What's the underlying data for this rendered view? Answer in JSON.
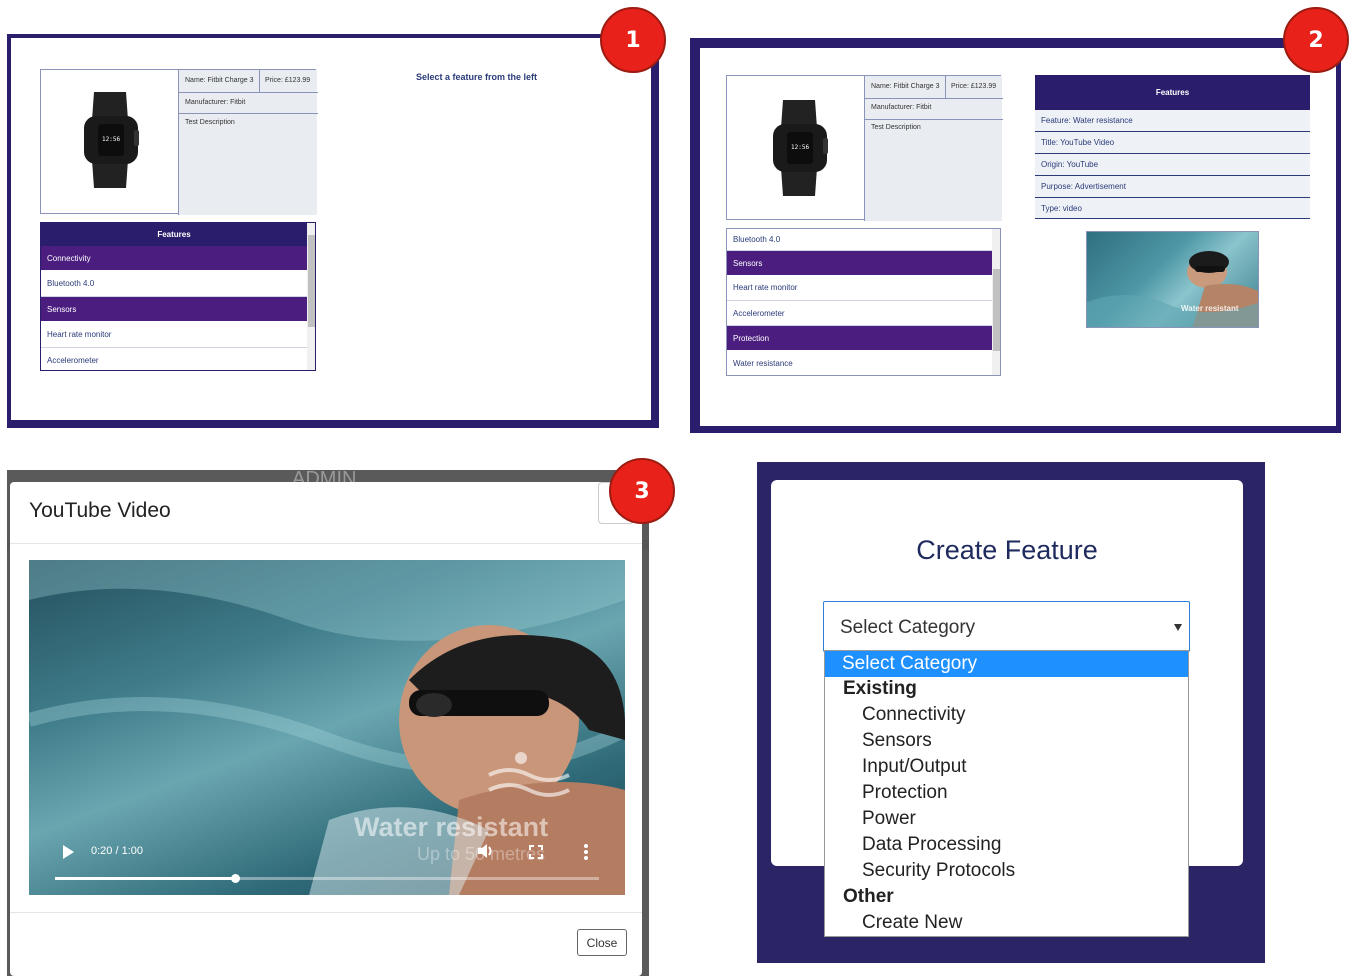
{
  "badges": [
    "1",
    "2",
    "3"
  ],
  "product": {
    "name": "Name: Fitbit Charge 3",
    "price": "Price: £123.99",
    "manufacturer": "Manufacturer: Fitbit",
    "description": "Test Description",
    "watch_time": "12:56"
  },
  "panel1": {
    "prompt": "Select a feature from the left",
    "features_title": "Features",
    "rows": [
      "Connectivity",
      "Bluetooth 4.0",
      "Sensors",
      "Heart rate monitor",
      "Accelerometer"
    ]
  },
  "panel2": {
    "rows": [
      "Bluetooth 4.0",
      "Sensors",
      "Heart rate monitor",
      "Accelerometer",
      "Protection",
      "Water resistance"
    ],
    "features_title": "Features",
    "details": [
      "Feature: Water resistance",
      "Title: YouTube Video",
      "Origin: YouTube",
      "Purpose: Advertisement",
      "Type: video"
    ],
    "thumb_caption": "Water resistant"
  },
  "panel3": {
    "bg_text": "ADMIN",
    "title": "YouTube Video",
    "video_overlay": "Water resistant",
    "video_subtext": "Up to 50 metres",
    "time": "0:20 / 1:00",
    "progress": 0.33,
    "close_label": "Close"
  },
  "panel4": {
    "title": "Create Feature",
    "select_value": "Select Category",
    "dropdown": {
      "highlighted": "Select Category",
      "group1": "Existing",
      "group1_items": [
        "Connectivity",
        "Sensors",
        "Input/Output",
        "Protection",
        "Power",
        "Data Processing",
        "Security Protocols"
      ],
      "group2": "Other",
      "group2_items": [
        "Create New"
      ]
    }
  },
  "colors": {
    "navy": "#2a1d6b",
    "purple": "#4b1d7f",
    "badge": "#e8211a",
    "highlight": "#1e90ff"
  }
}
